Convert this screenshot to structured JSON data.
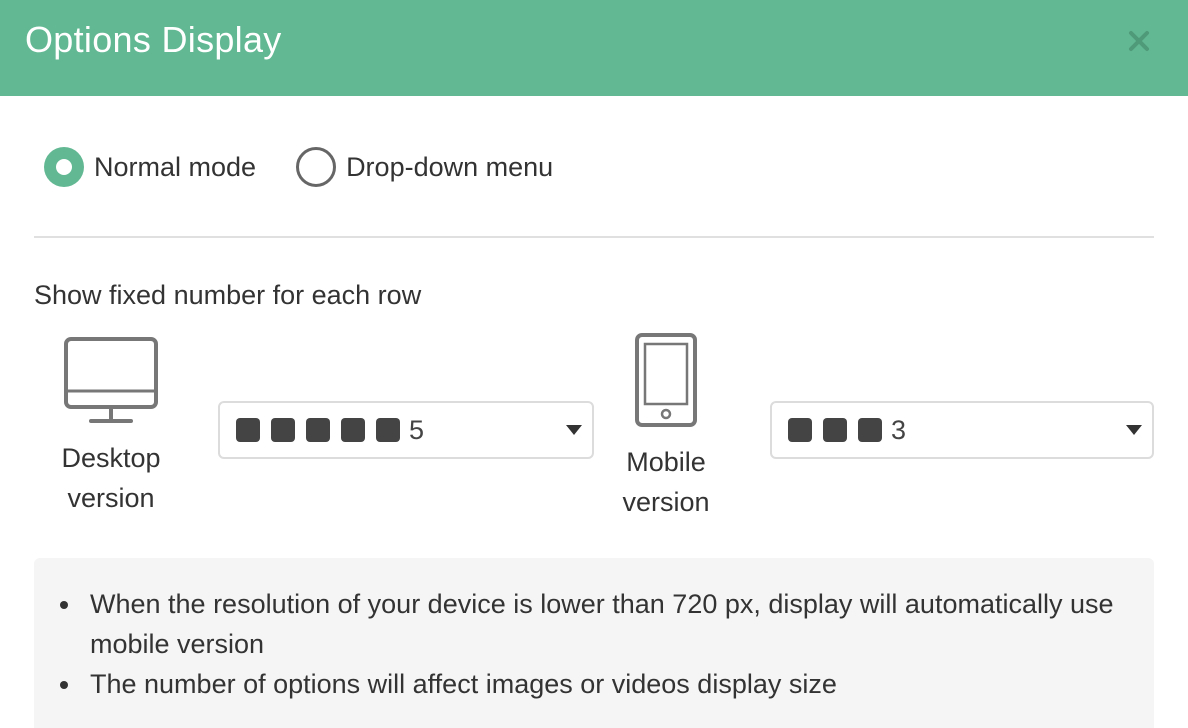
{
  "dialog": {
    "title": "Options Display",
    "close_icon": "close-icon"
  },
  "modes": [
    {
      "label": "Normal mode",
      "checked": true
    },
    {
      "label": "Drop-down menu",
      "checked": false
    }
  ],
  "section_label": "Show fixed number for each row",
  "desktop": {
    "icon": "desktop-monitor-icon",
    "caption_line1": "Desktop",
    "caption_line2": "version",
    "selected_value": "5",
    "square_count": 5
  },
  "mobile": {
    "icon": "mobile-phone-icon",
    "caption_line1": "Mobile",
    "caption_line2": "version",
    "selected_value": "3",
    "square_count": 3
  },
  "notes": [
    "When the resolution of your device is lower than 720 px, display will automatically use mobile version",
    "The number of options will affect images or videos display size"
  ],
  "colors": {
    "header": "#62b893",
    "accent": "#62b893"
  }
}
